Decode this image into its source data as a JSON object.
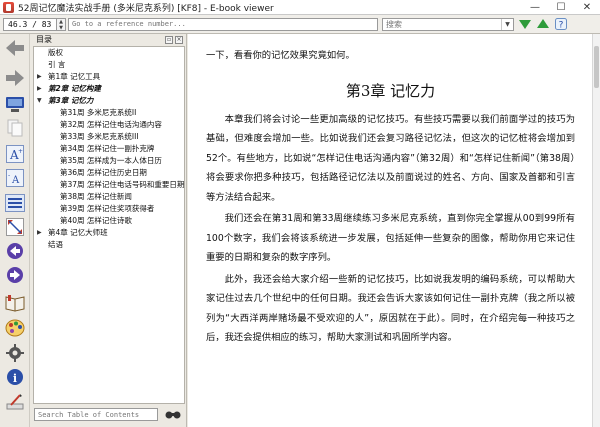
{
  "window": {
    "title": "52周记忆魔法实战手册 (多米尼克系列) [KF8] - E-book viewer",
    "minimize": "—",
    "maximize": "☐",
    "close": "✕"
  },
  "toolbar": {
    "position": "46.3 / 83",
    "reference_placeholder": "Go to a reference number...",
    "search_placeholder": "搜索"
  },
  "colors": {
    "accent_blue": "#2b4fa8",
    "nav_green": "#2e9b3a",
    "nav_purple": "#5a3fa8"
  },
  "toc": {
    "header": "目录",
    "items": [
      {
        "label": "版权",
        "level": 0,
        "arrow": ""
      },
      {
        "label": "引 言",
        "level": 0,
        "arrow": ""
      },
      {
        "label": "第1章 记忆工具",
        "level": 0,
        "arrow": "▶"
      },
      {
        "label": "第2章 记忆构建",
        "level": 0,
        "arrow": "▶",
        "bold": true
      },
      {
        "label": "第3章 记忆力",
        "level": 0,
        "arrow": "▼",
        "bold": true
      },
      {
        "label": "第31周 多米尼克系统II",
        "level": 1
      },
      {
        "label": "第32周 怎样记住电话沟通内容",
        "level": 1
      },
      {
        "label": "第33周 多米尼克系统III",
        "level": 1
      },
      {
        "label": "第34周 怎样记住一副扑克牌",
        "level": 1
      },
      {
        "label": "第35周 怎样成为一本人体日历",
        "level": 1
      },
      {
        "label": "第36周 怎样记住历史日期",
        "level": 1
      },
      {
        "label": "第37周 怎样记住电话号码和重要日期",
        "level": 1
      },
      {
        "label": "第38周 怎样记住新闻",
        "level": 1
      },
      {
        "label": "第39周 怎样记住奖项获得者",
        "level": 1
      },
      {
        "label": "第40周 怎样记住诗歌",
        "level": 1
      },
      {
        "label": "第4章 记忆大师班",
        "level": 0,
        "arrow": "▶"
      },
      {
        "label": "结语",
        "level": 0,
        "arrow": ""
      }
    ],
    "search_placeholder": "Search Table of Contents"
  },
  "content": {
    "intro_line": "一下，看看你的记忆效果究竟如何。",
    "chapter_title": "第3章 记忆力",
    "paragraphs": [
      "本章我们将会讨论一些更加高级的记忆技巧。有些技巧需要以我们前面学过的技巧为基础，但难度会增加一些。比如说我们还会复习路径记忆法，但这次的记忆桩将会增加到52个。有些地方，比如说“怎样记住电话沟通内容”（第32周）和“怎样记住新闻”（第38周）将会要求你把多种技巧，包括路径记忆法以及前面说过的姓名、方向、国家及首都和引言等方法结合起来。",
      "我们还会在第31周和第33周继续练习多米尼克系统，直到你完全掌握从00到99所有100个数字，我们会将该系统进一步发展，包括延伸一些复杂的图像，帮助你用它来记住重要的日期和复杂的数字序列。",
      "此外，我还会给大家介绍一些新的记忆技巧，比如说我发明的编码系统，可以帮助大家记住过去几个世纪中的任何日期。我还会告诉大家该如何记住一副扑克牌（我之所以被列为“大西洋两岸赌场最不受欢迎的人”，原因就在于此）。同时，在介绍完每一种技巧之后，我还会提供相应的练习，帮助大家测试和巩固所学内容。"
    ]
  }
}
